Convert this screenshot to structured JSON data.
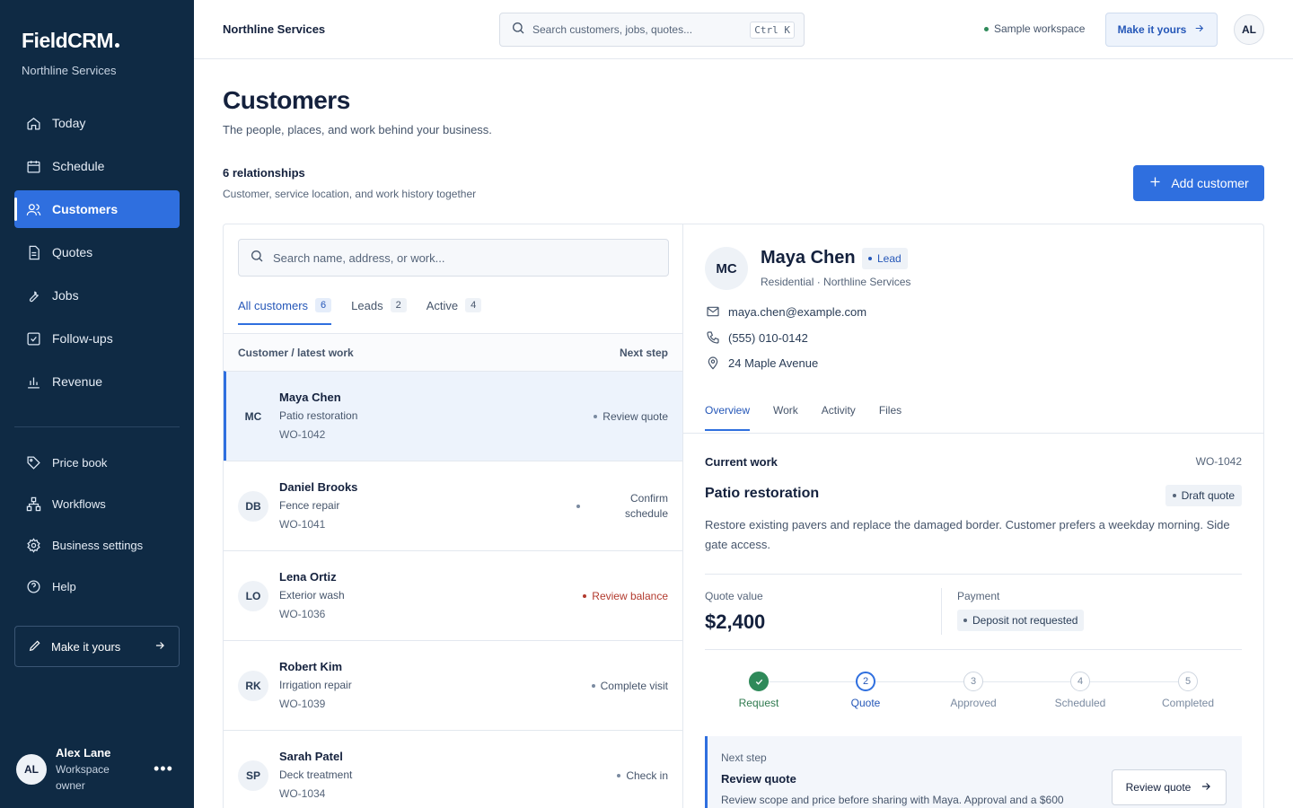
{
  "app": {
    "brand": "FieldCRM",
    "org": "Northline Services"
  },
  "sidebar": {
    "items": [
      {
        "label": "Today",
        "icon": "home-icon"
      },
      {
        "label": "Schedule",
        "icon": "calendar-icon"
      },
      {
        "label": "Customers",
        "icon": "users-icon",
        "active": true
      },
      {
        "label": "Quotes",
        "icon": "document-icon"
      },
      {
        "label": "Jobs",
        "icon": "wrench-icon"
      },
      {
        "label": "Follow-ups",
        "icon": "checkbox-icon"
      },
      {
        "label": "Revenue",
        "icon": "bar-chart-icon"
      }
    ],
    "secondary": [
      {
        "label": "Price book",
        "icon": "tag-icon"
      },
      {
        "label": "Workflows",
        "icon": "workflow-icon"
      },
      {
        "label": "Business settings",
        "icon": "settings-icon"
      },
      {
        "label": "Help",
        "icon": "help-icon"
      }
    ],
    "make_yours": "Make it yours",
    "user": {
      "initials": "AL",
      "name": "Alex Lane",
      "role_line1": "Workspace",
      "role_line2": "owner"
    }
  },
  "topbar": {
    "title": "Northline Services",
    "search_placeholder": "Search customers, jobs, quotes...",
    "shortcut": "Ctrl K",
    "workspace_badge": "Sample workspace",
    "make_yours": "Make it yours",
    "avatar": "AL"
  },
  "page": {
    "title": "Customers",
    "subtitle": "The people, places, and work behind your business.",
    "count_label": "6 relationships",
    "count_sub": "Customer, service location, and work history together",
    "add_button": "Add customer"
  },
  "list": {
    "search_placeholder": "Search name, address, or work...",
    "tabs": [
      {
        "label": "All customers",
        "count": "6"
      },
      {
        "label": "Leads",
        "count": "2"
      },
      {
        "label": "Active",
        "count": "4"
      }
    ],
    "header_left": "Customer / latest work",
    "header_right": "Next step",
    "rows": [
      {
        "initials": "MC",
        "name": "Maya Chen",
        "work": "Patio restoration",
        "id": "WO-1042",
        "step": "Review quote"
      },
      {
        "initials": "DB",
        "name": "Daniel Brooks",
        "work": "Fence repair",
        "id": "WO-1041",
        "step_line1": "Confirm",
        "step_line2": "schedule"
      },
      {
        "initials": "LO",
        "name": "Lena Ortiz",
        "work": "Exterior wash",
        "id": "WO-1036",
        "step": "Review balance"
      },
      {
        "initials": "RK",
        "name": "Robert Kim",
        "work": "Irrigation repair",
        "id": "WO-1039",
        "step": "Complete visit"
      },
      {
        "initials": "SP",
        "name": "Sarah Patel",
        "work": "Deck treatment",
        "id": "WO-1034",
        "step": "Check in"
      }
    ]
  },
  "detail": {
    "initials": "MC",
    "name": "Maya Chen",
    "badge": "Lead",
    "meta": "Residential · Northline Services",
    "email": "maya.chen@example.com",
    "phone": "(555) 010-0142",
    "address": "24 Maple Avenue",
    "tabs": [
      "Overview",
      "Work",
      "Activity",
      "Files"
    ],
    "current_work": {
      "label": "Current work",
      "id": "WO-1042",
      "title": "Patio restoration",
      "status": "Draft quote",
      "description": "Restore existing pavers and replace the damaged border. Customer prefers a weekday morning. Side gate access."
    },
    "quote_label": "Quote value",
    "quote_value": "$2,400",
    "payment_label": "Payment",
    "payment_status": "Deposit not requested",
    "steps": [
      {
        "num": "1",
        "label": "Request",
        "state": "done"
      },
      {
        "num": "2",
        "label": "Quote",
        "state": "current"
      },
      {
        "num": "3",
        "label": "Approved",
        "state": "todo"
      },
      {
        "num": "4",
        "label": "Scheduled",
        "state": "todo"
      },
      {
        "num": "5",
        "label": "Completed",
        "state": "todo"
      }
    ],
    "next_step": {
      "label": "Next step",
      "title": "Review quote",
      "description": "Review scope and price before sharing with Maya. Approval and a $600",
      "button": "Review quote"
    }
  },
  "colors": {
    "sidebar_bg": "#0f2a44",
    "accent": "#2f6fdf",
    "success": "#2f8a5a",
    "warning": "#b23a2e"
  }
}
